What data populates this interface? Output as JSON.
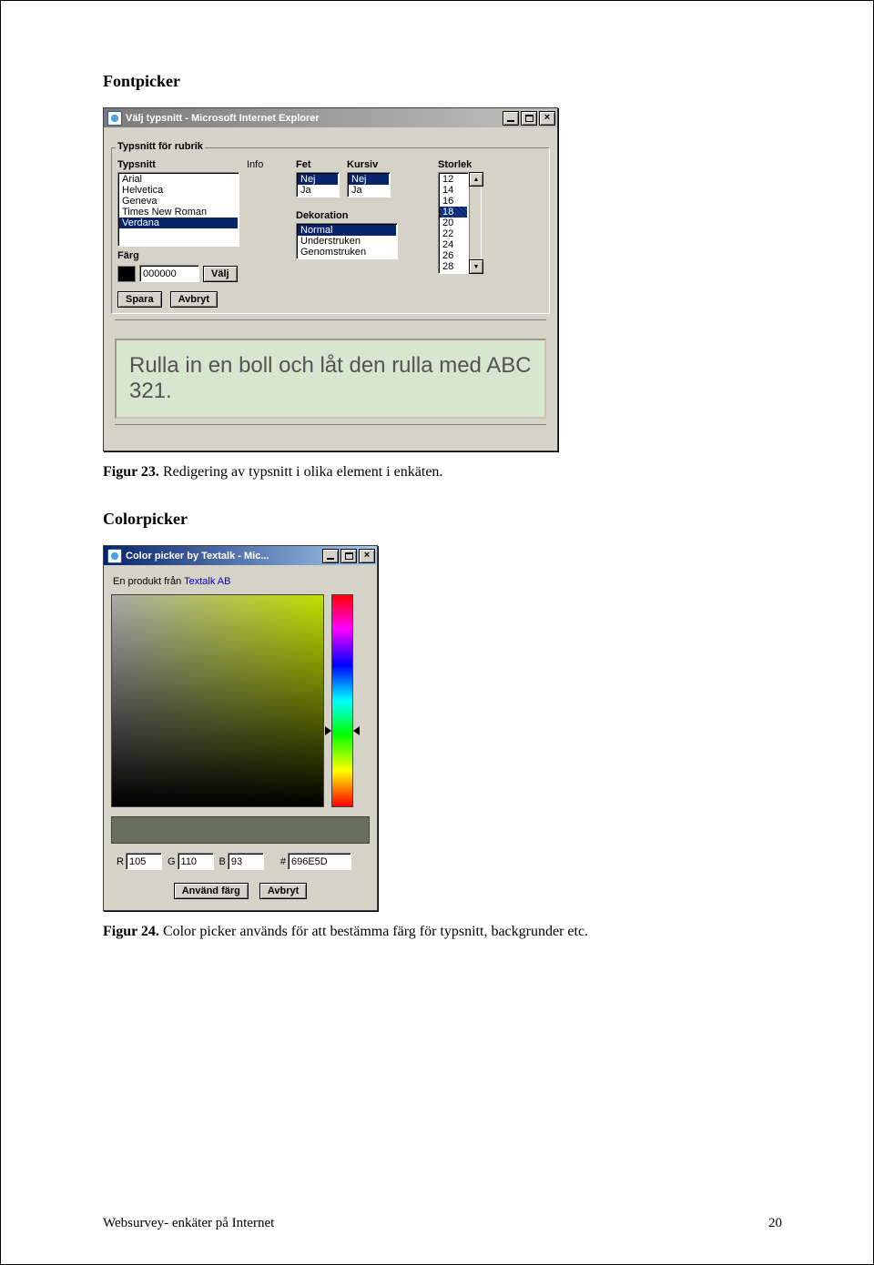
{
  "section1_title": "Fontpicker",
  "fig23_num": "Figur 23.",
  "fig23_txt": " Redigering av typsnitt i olika element i enkäten.",
  "fp_title": "Välj typsnitt - Microsoft Internet Explorer",
  "fp_legend": "Typsnitt för rubrik",
  "fp_labels": {
    "typsnitt": "Typsnitt",
    "info": "Info",
    "fet": "Fet",
    "kursiv": "Kursiv",
    "storlek": "Storlek",
    "dekoration": "Dekoration",
    "farg": "Färg"
  },
  "fonts": [
    "Arial",
    "Helvetica",
    "Geneva",
    "Times New Roman",
    "Verdana"
  ],
  "font_sel": "Verdana",
  "fet": [
    "Nej",
    "Ja"
  ],
  "fet_sel": "Nej",
  "kursiv": [
    "Nej",
    "Ja"
  ],
  "kursiv_sel": "Nej",
  "dekoration": [
    "Normal",
    "Understruken",
    "Genomstruken"
  ],
  "dekoration_sel": "Normal",
  "sizes": [
    "12",
    "14",
    "16",
    "18",
    "20",
    "22",
    "24",
    "26",
    "28"
  ],
  "size_sel": "18",
  "farg_value": "000000",
  "btn_valj": "Välj",
  "btn_spara": "Spara",
  "btn_avbryt": "Avbryt",
  "preview": "Rulla in en boll och låt den rulla med ABC 321.",
  "section2_title": "Colorpicker",
  "cp_title": "Color picker by Textalk - Mic...",
  "cp_intro_prefix": "En produkt från ",
  "cp_intro_link": "Textalk AB",
  "cp_r": "105",
  "cp_g": "110",
  "cp_b": "93",
  "cp_hex": "696E5D",
  "cp_lbl_r": "R",
  "cp_lbl_g": "G",
  "cp_lbl_b": "B",
  "cp_lbl_hash": "#",
  "cp_btn_use": "Använd färg",
  "cp_btn_cancel": "Avbryt",
  "fig24_num": "Figur 24.",
  "fig24_txt": " Color picker används för att bestämma färg för typsnitt, backgrunder etc.",
  "footer_left": "Websurvey- enkäter på Internet",
  "footer_right": "20"
}
